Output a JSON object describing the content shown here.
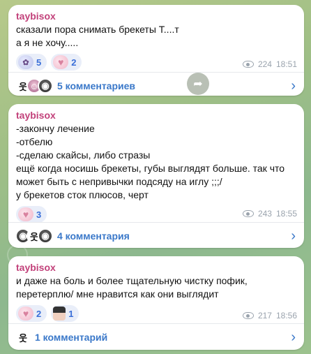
{
  "posts": [
    {
      "author": "taybisox",
      "text": "сказали пора снимать брекеты Т....т\nа я не хочу.....",
      "reactions": [
        {
          "emoji_icon": "sticker-icon",
          "count": "5"
        },
        {
          "emoji_icon": "heart-icon",
          "count": "2"
        }
      ],
      "views": "224",
      "time": "18:51",
      "comments_label": "5 комментариев"
    },
    {
      "author": "taybisox",
      "text": "-закончу лечение\n-отбелю\n-сделаю скайсы, либо стразы\nещё когда носишь брекеты, губы выглядят больше. так что может быть с непривычки подсяду на иглу ;;;/\nу брекетов сток плюсов, черт",
      "reactions": [
        {
          "emoji_icon": "heart-icon",
          "count": "3"
        }
      ],
      "views": "243",
      "time": "18:55",
      "comments_label": "4 комментария"
    },
    {
      "author": "taybisox",
      "text": "и даже на боль и более тщательную чистку пофик, перетерплю/ мне нравится как они  выглядит",
      "reactions": [
        {
          "emoji_icon": "heart-icon",
          "count": "2"
        },
        {
          "emoji_icon": "girl-sticker-icon",
          "count": "1"
        }
      ],
      "views": "217",
      "time": "18:56",
      "comments_label": "1 комментарий"
    }
  ],
  "colors": {
    "author": "#c2417a",
    "link": "#3a78c9",
    "meta": "#9aa3ad",
    "reaction_bg": "#e9eef9"
  }
}
